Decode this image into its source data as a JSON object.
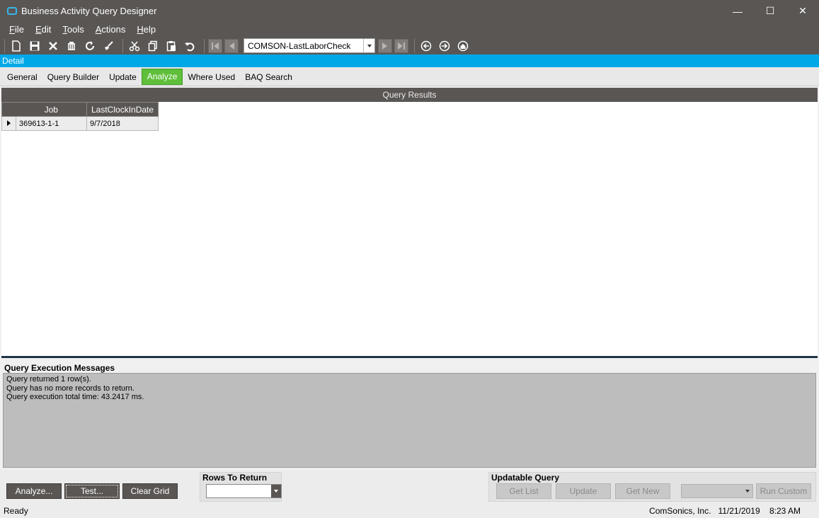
{
  "window": {
    "title": "Business Activity Query Designer",
    "controls": {
      "minimize": "—",
      "maximize": "☐",
      "close": "✕"
    }
  },
  "menu": [
    "File",
    "Edit",
    "Tools",
    "Actions",
    "Help"
  ],
  "toolbar": {
    "query_selector_value": "COMSON-LastLaborCheck"
  },
  "detail_label": "Detail",
  "tabs": [
    "General",
    "Query Builder",
    "Update",
    "Analyze",
    "Where Used",
    "BAQ Search"
  ],
  "active_tab": "Analyze",
  "results": {
    "header": "Query Results",
    "columns": [
      "Job",
      "LastClockInDate"
    ],
    "rows": [
      {
        "job": "369613-1-1",
        "last_clock_in_date": "9/7/2018"
      }
    ]
  },
  "messages": {
    "title": "Query Execution Messages",
    "lines": [
      "Query returned 1 row(s).",
      "Query has no more records to return.",
      "Query execution total time: 43.2417 ms."
    ]
  },
  "buttons": {
    "analyze": "Analyze...",
    "test": "Test...",
    "clear_grid": "Clear Grid"
  },
  "rows_to_return": {
    "label": "Rows To Return",
    "value": ""
  },
  "updatable_query": {
    "label": "Updatable Query",
    "get_list": "Get List",
    "update": "Update",
    "get_new": "Get New",
    "run_custom": "Run Custom"
  },
  "status": {
    "text": "Ready",
    "company": "ComSonics, Inc.",
    "date": "11/21/2019",
    "time": "8:23 AM"
  },
  "colors": {
    "chrome": "#5a5654",
    "detail_bar": "#00a8e8",
    "active_tab": "#5fbf3a"
  }
}
